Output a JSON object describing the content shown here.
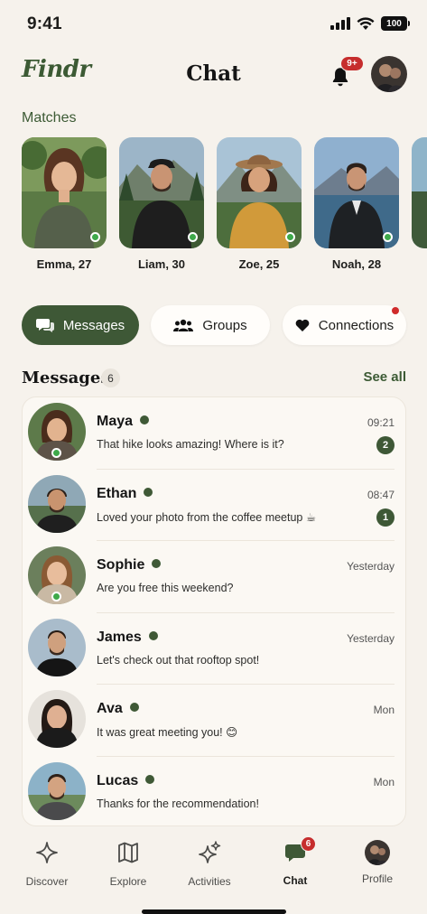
{
  "status_bar": {
    "time": "9:41",
    "battery": "100"
  },
  "header": {
    "logo": "Findr",
    "title": "Chat",
    "notification_badge": "9+"
  },
  "matches": {
    "title": "Matches",
    "items": [
      {
        "name": "Emma, 27",
        "online": true
      },
      {
        "name": "Liam, 30",
        "online": true
      },
      {
        "name": "Zoe, 25",
        "online": true
      },
      {
        "name": "Noah, 28",
        "online": true
      }
    ]
  },
  "tabs": [
    {
      "label": "Messages",
      "active": true
    },
    {
      "label": "Groups",
      "active": false
    },
    {
      "label": "Connections",
      "active": false,
      "has_notification": true
    }
  ],
  "messages": {
    "title": "Messages",
    "count": "6",
    "see_all": "See all",
    "items": [
      {
        "name": "Maya",
        "preview": "That hike looks amazing! Where is it?",
        "time": "09:21",
        "unread": "2",
        "online": true
      },
      {
        "name": "Ethan",
        "preview": "Loved your photo from the coffee meetup ☕",
        "time": "08:47",
        "unread": "1",
        "online": false
      },
      {
        "name": "Sophie",
        "preview": "Are you free this weekend?",
        "time": "Yesterday",
        "unread": null,
        "online": true
      },
      {
        "name": "James",
        "preview": "Let's check out that rooftop spot!",
        "time": "Yesterday",
        "unread": null,
        "online": false
      },
      {
        "name": "Ava",
        "preview": "It was great meeting you! 😊",
        "time": "Mon",
        "unread": null,
        "online": false
      },
      {
        "name": "Lucas",
        "preview": "Thanks for the recommendation!",
        "time": "Mon",
        "unread": null,
        "online": false
      }
    ]
  },
  "bottom_nav": {
    "items": [
      {
        "label": "Discover",
        "icon": "sparkle-icon"
      },
      {
        "label": "Explore",
        "icon": "map-icon"
      },
      {
        "label": "Activities",
        "icon": "sparkles-icon"
      },
      {
        "label": "Chat",
        "icon": "chat-bubble-icon",
        "badge": "6",
        "active": true
      },
      {
        "label": "Profile",
        "icon": "profile-avatar"
      }
    ]
  },
  "colors": {
    "brand": "#3e5836",
    "badge": "#c62d2d",
    "online": "#3ea94a",
    "background": "#f6f2ec"
  }
}
